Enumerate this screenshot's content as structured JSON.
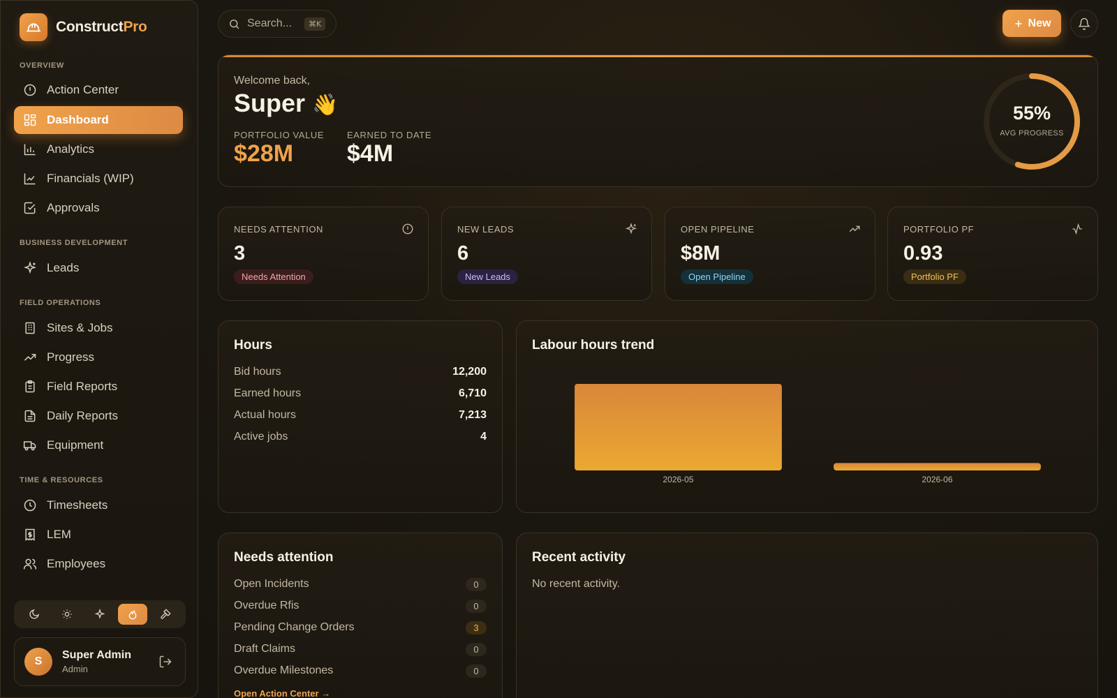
{
  "brand": {
    "name_main": "Construct",
    "name_accent": "Pro"
  },
  "sidebar": {
    "sections": [
      "OVERVIEW",
      "BUSINESS DEVELOPMENT",
      "FIELD OPERATIONS",
      "TIME & RESOURCES"
    ],
    "items": [
      {
        "label": "Action Center",
        "icon": "alert-circle-icon"
      },
      {
        "label": "Dashboard",
        "icon": "grid-icon",
        "active": true
      },
      {
        "label": "Analytics",
        "icon": "bar-chart-icon"
      },
      {
        "label": "Financials (WIP)",
        "icon": "line-chart-icon"
      },
      {
        "label": "Approvals",
        "icon": "check-square-icon"
      },
      {
        "label": "Leads",
        "icon": "sparkles-icon"
      },
      {
        "label": "Sites & Jobs",
        "icon": "building-icon"
      },
      {
        "label": "Progress",
        "icon": "trending-up-icon"
      },
      {
        "label": "Field Reports",
        "icon": "clipboard-icon"
      },
      {
        "label": "Daily Reports",
        "icon": "file-text-icon"
      },
      {
        "label": "Equipment",
        "icon": "truck-icon"
      },
      {
        "label": "Timesheets",
        "icon": "clock-icon"
      },
      {
        "label": "LEM",
        "icon": "receipt-icon"
      },
      {
        "label": "Employees",
        "icon": "users-icon"
      }
    ],
    "themes": [
      "moon-icon",
      "sun-icon",
      "sparkles-icon",
      "flame-icon",
      "hammer-icon"
    ],
    "active_theme": "flame-icon"
  },
  "user": {
    "initial": "S",
    "name": "Super Admin",
    "role": "Admin"
  },
  "topbar": {
    "search_placeholder": "Search...",
    "shortcut": "⌘K",
    "new_label": "New"
  },
  "welcome": {
    "greeting": "Welcome back,",
    "name": "Super",
    "emoji": "👋",
    "portfolio_label": "PORTFOLIO VALUE",
    "portfolio_value": "$28M",
    "earned_label": "EARNED TO DATE",
    "earned_value": "$4M",
    "progress_pct": 55,
    "progress_text": "55%",
    "progress_label": "AVG PROGRESS"
  },
  "stats": [
    {
      "label": "NEEDS ATTENTION",
      "value": "3",
      "pill": "Needs Attention",
      "icon": "alert-circle-icon",
      "pill_bg": "#3a1d1d",
      "pill_fg": "#f2a6a6"
    },
    {
      "label": "NEW LEADS",
      "value": "6",
      "pill": "New Leads",
      "icon": "sparkles-icon",
      "pill_bg": "#2a2240",
      "pill_fg": "#c9bdf5"
    },
    {
      "label": "OPEN PIPELINE",
      "value": "$8M",
      "pill": "Open Pipeline",
      "icon": "trending-up-icon",
      "pill_bg": "#14303a",
      "pill_fg": "#8fd6ef"
    },
    {
      "label": "PORTFOLIO PF",
      "value": "0.93",
      "pill": "Portfolio PF",
      "icon": "activity-icon",
      "pill_bg": "#3a2d12",
      "pill_fg": "#f0c35a"
    }
  ],
  "hours": {
    "title": "Hours",
    "rows": [
      {
        "k": "Bid hours",
        "v": "12,200"
      },
      {
        "k": "Earned hours",
        "v": "6,710"
      },
      {
        "k": "Actual hours",
        "v": "7,213"
      },
      {
        "k": "Active jobs",
        "v": "4"
      }
    ]
  },
  "trend": {
    "title": "Labour hours trend"
  },
  "chart_data": {
    "type": "bar",
    "title": "Labour hours trend",
    "categories": [
      "2026-05",
      "2026-06"
    ],
    "values": [
      7000,
      600
    ],
    "ylim": [
      0,
      7000
    ]
  },
  "attention": {
    "title": "Needs attention",
    "rows": [
      {
        "k": "Open Incidents",
        "v": "0"
      },
      {
        "k": "Overdue Rfis",
        "v": "0"
      },
      {
        "k": "Pending Change Orders",
        "v": "3",
        "hot": true
      },
      {
        "k": "Draft Claims",
        "v": "0"
      },
      {
        "k": "Overdue Milestones",
        "v": "0"
      }
    ],
    "link": "Open Action Center →"
  },
  "recent": {
    "title": "Recent activity",
    "empty": "No recent activity."
  },
  "colors": {
    "accent": "#f0a24a",
    "accent_dark": "#dd8a44",
    "bg": "#1b1710"
  }
}
